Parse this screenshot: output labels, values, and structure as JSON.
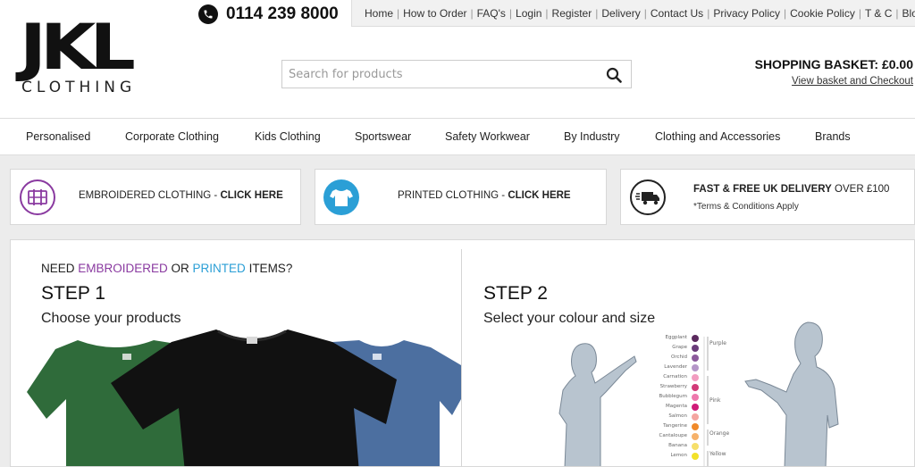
{
  "header": {
    "logo_main": "JKL",
    "logo_sub": "CLOTHING",
    "phone": "0114 239 8000",
    "top_links": [
      "Home",
      "How to Order",
      "FAQ's",
      "Login",
      "Register",
      "Delivery",
      "Contact Us",
      "Privacy Policy",
      "Cookie Policy",
      "T & C",
      "Blog"
    ],
    "search_placeholder": "Search for products",
    "basket_title": "SHOPPING BASKET: £0.00",
    "basket_link": "View basket and Checkout"
  },
  "main_nav": [
    "Personalised",
    "Corporate Clothing",
    "Kids Clothing",
    "Sportswear",
    "Safety Workwear",
    "By Industry",
    "Clothing and Accessories",
    "Brands"
  ],
  "features": {
    "embroidered": {
      "text": "EMBROIDERED CLOTHING - ",
      "cta": "CLICK HERE"
    },
    "printed": {
      "text": "PRINTED CLOTHING - ",
      "cta": "CLICK HERE"
    },
    "delivery": {
      "bold": "FAST & FREE UK DELIVERY",
      "text": " OVER £100",
      "sub": "*Terms & Conditions Apply"
    }
  },
  "steps": {
    "need_prefix": "NEED ",
    "need_embroidered": "EMBROIDERED",
    "need_or": " OR ",
    "need_printed": "PRINTED",
    "need_suffix": " ITEMS?",
    "step1_title": "STEP 1",
    "step1_sub": "Choose your products",
    "step2_title": "STEP 2",
    "step2_sub": "Select your colour and size"
  },
  "colour_chart": {
    "swatches": [
      "Eggplant",
      "Grape",
      "Orchid",
      "Lavender",
      "Carnation",
      "Strawberry",
      "Bubblegum",
      "Magenta",
      "Salmon",
      "Tangerine",
      "Cantaloupe",
      "Banana",
      "Lemon"
    ],
    "groups": [
      "Purple",
      "Pink",
      "Orange",
      "Yellow"
    ]
  },
  "colors": {
    "embroidered_accent": "#8a3aa0",
    "printed_accent": "#2b9fd6",
    "tshirt_green": "#2f6b3a",
    "tshirt_black": "#111111",
    "tshirt_blue": "#4c6fa0"
  }
}
